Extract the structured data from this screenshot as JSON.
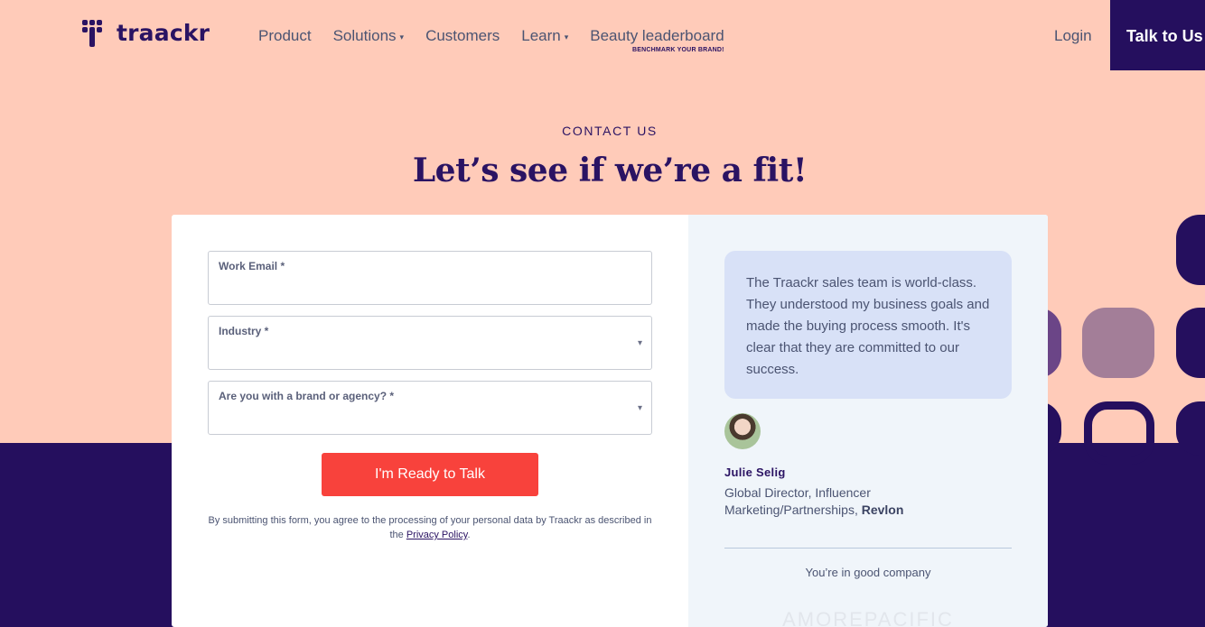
{
  "header": {
    "logo_text": "traackr",
    "nav": [
      {
        "label": "Product",
        "dropdown": false
      },
      {
        "label": "Solutions",
        "dropdown": true
      },
      {
        "label": "Customers",
        "dropdown": false
      },
      {
        "label": "Learn",
        "dropdown": true
      },
      {
        "label": "Beauty leaderboard",
        "dropdown": false,
        "sublabel": "BENCHMARK YOUR BRAND!"
      }
    ],
    "login_label": "Login",
    "cta_label": "Talk to Us"
  },
  "hero": {
    "eyebrow": "CONTACT US",
    "title": "Let’s see if we’re a fit!"
  },
  "form": {
    "fields": [
      {
        "label": "Work Email *",
        "value": "",
        "type": "input"
      },
      {
        "label": "Industry *",
        "value": "",
        "type": "select"
      },
      {
        "label": "Are you with a brand or agency? *",
        "value": "",
        "type": "select"
      }
    ],
    "submit_label": "I'm Ready to Talk",
    "consent_text": "By submitting this form, you agree to the processing of your personal data by Traackr as described in the ",
    "privacy_link": "Privacy Policy",
    "consent_end": "."
  },
  "testimonial": {
    "quote": "The Traackr sales team is world-class. They understood my business goals and made the buying process smooth. It's clear that they are committed to our success.",
    "name": "Julie Selig",
    "title_prefix": "Global Director, Influencer Marketing/Partnerships, ",
    "company": "Revlon",
    "company_label": "You’re in good company",
    "logo_strip": "AMOREPACIFIC"
  },
  "colors": {
    "background": "#ffcbb9",
    "brand_dark": "#250f5e",
    "cta_red": "#f8423c",
    "quote_bg": "#d8e1f7"
  },
  "icons": {
    "dropdown": "▾"
  }
}
